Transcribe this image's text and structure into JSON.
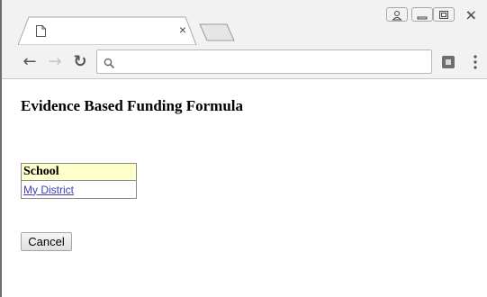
{
  "browser": {
    "tab": {
      "title": "",
      "close_glyph": "×"
    },
    "window_controls": [
      "user-icon",
      "minimize-icon",
      "maximize-icon",
      "close-icon"
    ],
    "toolbar": {
      "back_glyph": "←",
      "forward_glyph": "→",
      "reload_glyph": "↻",
      "address": {
        "value": "",
        "placeholder": ""
      }
    }
  },
  "page": {
    "title": "Evidence Based Funding Formula",
    "table": {
      "header": "School",
      "rows": [
        {
          "link_text": "My District"
        }
      ]
    },
    "cancel_label": "Cancel"
  },
  "colors": {
    "table_header_bg": "#ffffcc",
    "link": "#3f3fb8",
    "chrome_bg": "#f2f2f2"
  }
}
